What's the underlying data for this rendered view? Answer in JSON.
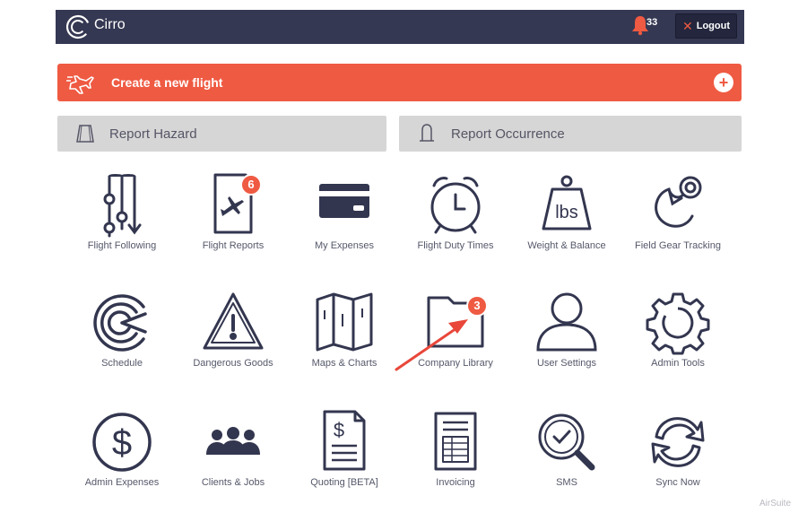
{
  "header": {
    "app_name": "Cirro",
    "notification_count": "33",
    "logout_label": "Logout"
  },
  "create_flight": {
    "label": "Create a new flight"
  },
  "reports": {
    "hazard_label": "Report Hazard",
    "occurrence_label": "Report Occurrence"
  },
  "tiles": [
    {
      "label": "Flight Following",
      "icon": "flight-following-icon"
    },
    {
      "label": "Flight Reports",
      "icon": "flight-reports-icon",
      "badge": "6"
    },
    {
      "label": "My Expenses",
      "icon": "credit-card-icon"
    },
    {
      "label": "Flight Duty Times",
      "icon": "alarm-clock-icon"
    },
    {
      "label": "Weight & Balance",
      "icon": "weight-icon",
      "icon_text": "lbs"
    },
    {
      "label": "Field Gear Tracking",
      "icon": "hook-icon"
    },
    {
      "label": "Schedule",
      "icon": "schedule-icon"
    },
    {
      "label": "Dangerous Goods",
      "icon": "warning-icon"
    },
    {
      "label": "Maps & Charts",
      "icon": "map-icon"
    },
    {
      "label": "Company Library",
      "icon": "folder-icon",
      "badge": "3"
    },
    {
      "label": "User Settings",
      "icon": "user-icon"
    },
    {
      "label": "Admin Tools",
      "icon": "gear-icon"
    },
    {
      "label": "Admin Expenses",
      "icon": "dollar-icon",
      "icon_text": "$"
    },
    {
      "label": "Clients & Jobs",
      "icon": "people-icon"
    },
    {
      "label": "Quoting [BETA]",
      "icon": "quote-document-icon",
      "icon_text": "$"
    },
    {
      "label": "Invoicing",
      "icon": "invoice-icon"
    },
    {
      "label": "SMS",
      "icon": "sms-search-icon"
    },
    {
      "label": "Sync Now",
      "icon": "sync-icon"
    }
  ],
  "watermark": "AirSuite",
  "colors": {
    "navy": "#353852",
    "accent": "#ef5a42",
    "icon": "#33364f",
    "grey_button": "#d6d6d6"
  }
}
